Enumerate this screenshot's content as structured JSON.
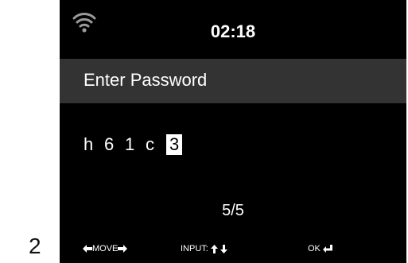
{
  "step_number": "2",
  "status_bar": {
    "wifi_icon": "wifi-icon",
    "time": "02:18"
  },
  "title": "Enter Password",
  "password": {
    "chars": [
      "h",
      "6",
      "1",
      "c"
    ],
    "cursor_char": "3"
  },
  "page_indicator": "5/5",
  "help": {
    "move_label": "MOVE",
    "input_label": "INPUT:",
    "ok_label": "OK"
  },
  "colors": {
    "screen_background": "#000000",
    "title_bar": "#333333",
    "text": "#ffffff",
    "cursor_highlight": "#ffffff"
  }
}
